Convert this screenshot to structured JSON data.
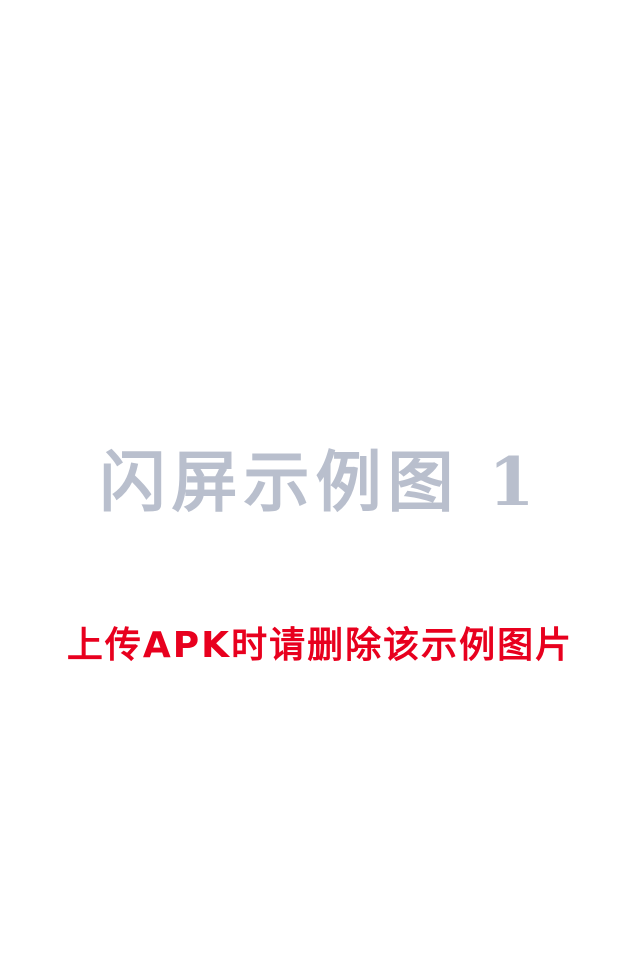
{
  "splash": {
    "title": "闪屏示例图 1",
    "notice": "上传APK时请删除该示例图片"
  },
  "colors": {
    "background": "#ffffff",
    "title": "#b9bfcd",
    "notice": "#e8001e"
  }
}
